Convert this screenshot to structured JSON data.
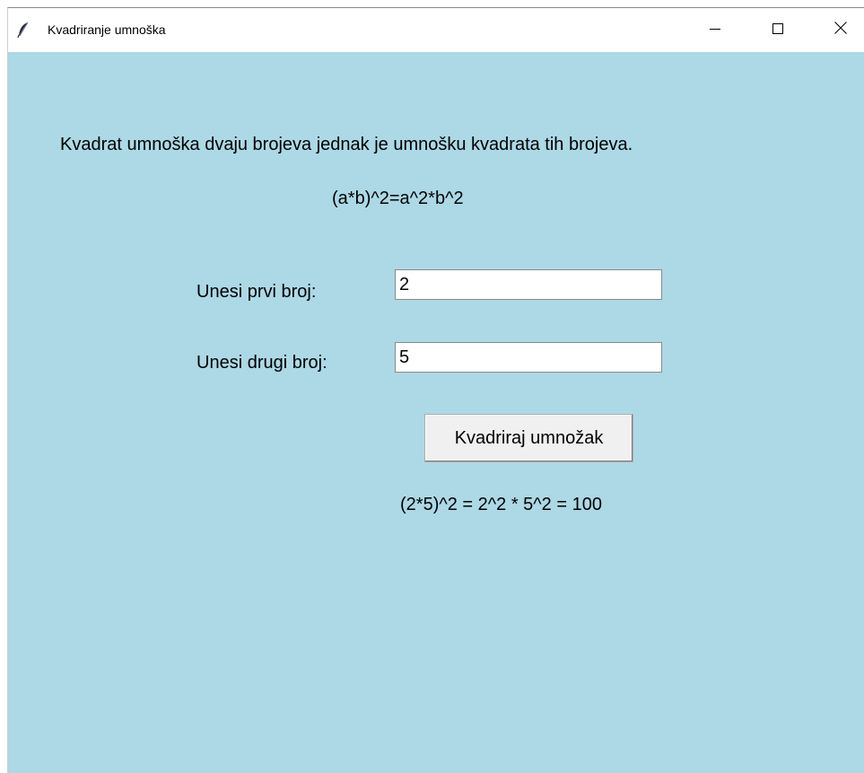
{
  "window": {
    "title": "Kvadriranje umnoška",
    "icon": "feather-icon",
    "controls": [
      "minimize-icon",
      "maximize-icon",
      "close-icon"
    ],
    "background": "#add8e6"
  },
  "content": {
    "description": "Kvadrat umnoška dvaju brojeva jednak je umnošku kvadrata tih brojeva.",
    "formula": "(a*b)^2=a^2*b^2",
    "first_label": "Unesi prvi broj:",
    "first_value": "2",
    "second_label": "Unesi drugi broj:",
    "second_value": "5",
    "button_label": "Kvadriraj umnožak",
    "result": "(2*5)^2 = 2^2 * 5^2 = 100"
  }
}
